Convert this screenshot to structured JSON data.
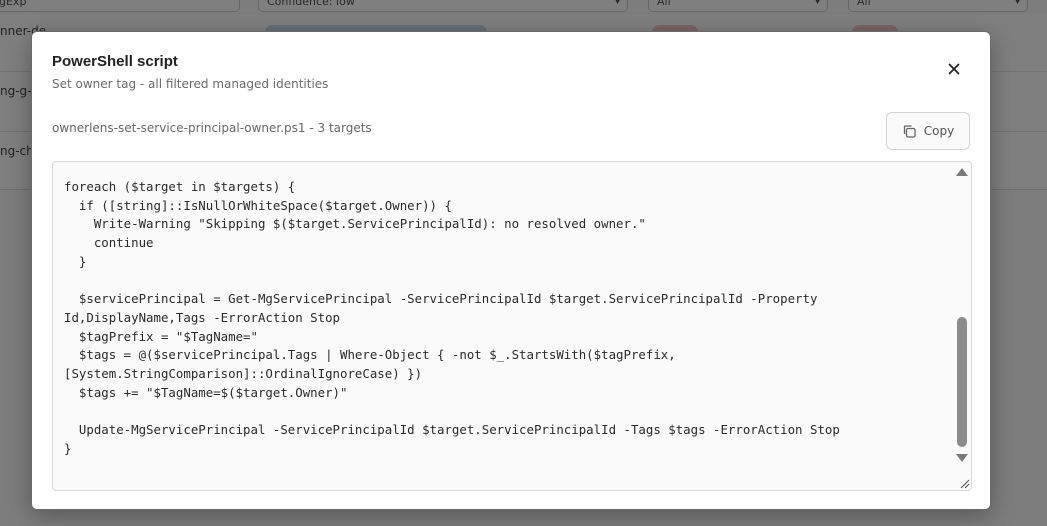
{
  "background": {
    "filters": [
      {
        "label": "gExp"
      },
      {
        "label": "Confidence: low"
      },
      {
        "label": "All"
      },
      {
        "label": "All"
      }
    ],
    "rows": [
      {
        "label": "nner-de"
      },
      {
        "label": "ng-g-"
      },
      {
        "label": "ng-ch"
      }
    ]
  },
  "modal": {
    "title": "PowerShell script",
    "subtitle": "Set owner tag - all filtered managed identities",
    "file_meta": "ownerlens-set-service-principal-owner.ps1 - 3 targets",
    "copy_label": "Copy",
    "code": "foreach ($target in $targets) {\n  if ([string]::IsNullOrWhiteSpace($target.Owner)) {\n    Write-Warning \"Skipping $($target.ServicePrincipalId): no resolved owner.\"\n    continue\n  }\n\n  $servicePrincipal = Get-MgServicePrincipal -ServicePrincipalId $target.ServicePrincipalId -Property\nId,DisplayName,Tags -ErrorAction Stop\n  $tagPrefix = \"$TagName=\"\n  $tags = @($servicePrincipal.Tags | Where-Object { -not $_.StartsWith($tagPrefix,\n[System.StringComparison]::OrdinalIgnoreCase) })\n  $tags += \"$TagName=$($target.Owner)\"\n\n  Update-MgServicePrincipal -ServicePrincipalId $target.ServicePrincipalId -Tags $tags -ErrorAction Stop\n}"
  },
  "colors": {
    "overlay": "#7f7f80",
    "modal_bg": "#ffffff",
    "code_bg": "#fafafa",
    "pill_blue": "#c7dcf5",
    "pill_red": "#f3c9c9"
  },
  "icons": {
    "close": "close-icon",
    "copy": "copy-icon",
    "scroll_up": "scroll-up-arrow-icon",
    "scroll_down": "scroll-down-arrow-icon",
    "resize": "resize-grip-icon"
  }
}
